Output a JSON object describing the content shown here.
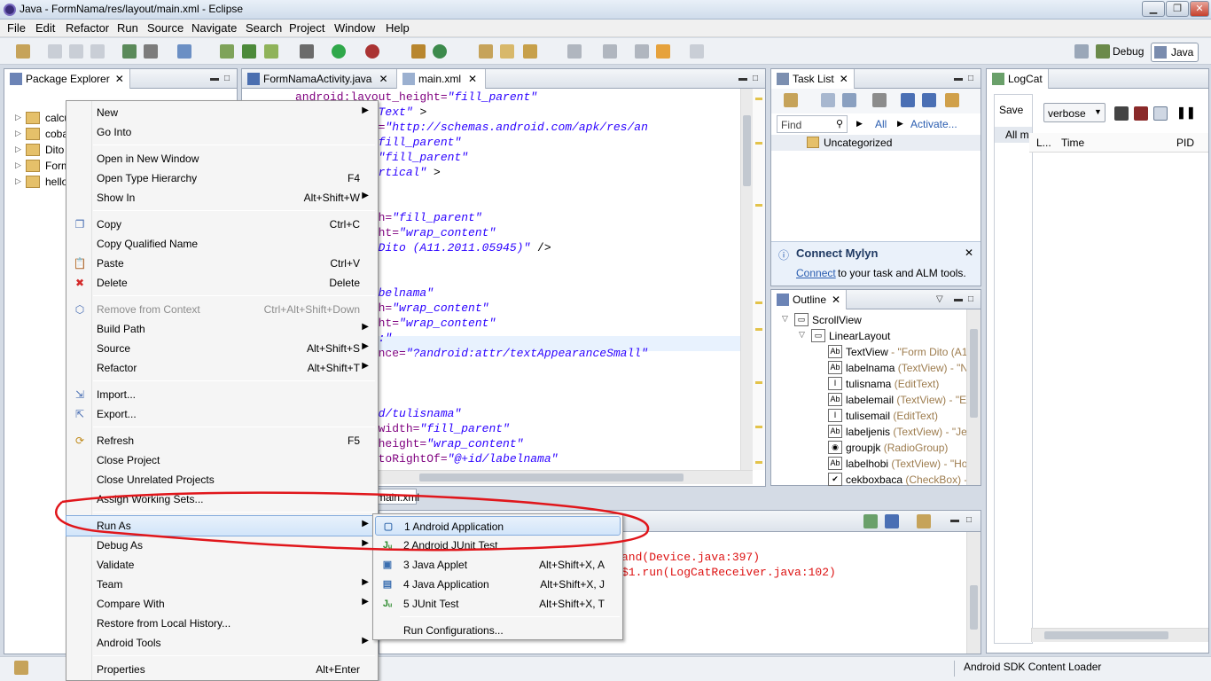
{
  "window": {
    "title": "Java - FormNama/res/layout/main.xml - Eclipse",
    "minimize": "▁",
    "maximize": "❐",
    "close": "✕"
  },
  "menubar": [
    "File",
    "Edit",
    "Refactor",
    "Run",
    "Source",
    "Navigate",
    "Search",
    "Project",
    "Window",
    "Help"
  ],
  "perspectives": {
    "debug": "Debug",
    "java": "Java"
  },
  "package_explorer": {
    "tab": "Package Explorer",
    "items": [
      "calcu",
      "coba",
      "Dito",
      "Form",
      "hello"
    ]
  },
  "editor": {
    "tabs": [
      "FormNamaActivity.java",
      "main.xml"
    ],
    "lines": [
      {
        "a": "android:layout_height=",
        "v": "\"fill_parent\"",
        "p": ""
      },
      {
        "a": "e=",
        "v": "\"HardcodedText\"",
        "p": " >"
      },
      {
        "a": "mlns:android=",
        "v": "\"http://schemas.android.com/apk/res/an",
        "p": ""
      },
      {
        "a": "yout_width=",
        "v": "\"fill_parent\"",
        "p": ""
      },
      {
        "a": "yout_height=",
        "v": "\"fill_parent\"",
        "p": ""
      },
      {
        "a": "entation=",
        "v": "\"vertical\"",
        "p": " >"
      },
      {
        "a": "",
        "v": "",
        "p": ""
      },
      {
        "a": "",
        "v": "",
        "p": ""
      },
      {
        "a": ":layout_width=",
        "v": "\"fill_parent\"",
        "p": ""
      },
      {
        "a": ":layout_height=",
        "v": "\"wrap_content\"",
        "p": ""
      },
      {
        "a": ":text=",
        "v": "\"Form Dito (A11.2011.05945)\"",
        "p": " />"
      },
      {
        "a": "",
        "v": "",
        "p": ""
      },
      {
        "a": "",
        "v": "",
        "p": ""
      },
      {
        "a": ":id=",
        "v": "\"@+id/labelnama\"",
        "p": ""
      },
      {
        "a": ":layout_width=",
        "v": "\"wrap_content\"",
        "p": ""
      },
      {
        "a": ":layout_height=",
        "v": "\"wrap_content\"",
        "p": ""
      },
      {
        "a": ":text=",
        "v": "\"Nama :\"",
        "p": ""
      },
      {
        "a": ":textAppearance=",
        "v": "\"?android:attr/textAppearanceSmall\"",
        "p": ""
      },
      {
        "a": "",
        "v": "",
        "p": ""
      },
      {
        "a": "",
        "v": "",
        "p": ""
      },
      {
        "a": "",
        "v": "",
        "p": ""
      },
      {
        "a": "roid:id=",
        "v": "\"@+id/tulisnama\"",
        "p": ""
      },
      {
        "a": "roid:layout_width=",
        "v": "\"fill_parent\"",
        "p": ""
      },
      {
        "a": "roid:layout_height=",
        "v": "\"wrap_content\"",
        "p": ""
      },
      {
        "a": "roid:layout_toRightOf=",
        "v": "\"@+id/labelnama\"",
        "p": ""
      }
    ],
    "bottom_tab": "main.xml"
  },
  "task_list": {
    "tab": "Task List",
    "find_placeholder": "Find",
    "all": "All",
    "activate": "Activate...",
    "category": "Uncategorized",
    "mylyn_title": "Connect Mylyn",
    "mylyn_link": "Connect",
    "mylyn_text": " to your task and ALM tools."
  },
  "outline": {
    "tab": "Outline",
    "items": [
      {
        "name": "ScrollView",
        "type": "",
        "indent": 0,
        "icon": "scrollview-icon",
        "glyph": "▭"
      },
      {
        "name": "LinearLayout",
        "type": "",
        "indent": 1,
        "icon": "linearlayout-icon",
        "glyph": "▭"
      },
      {
        "name": "TextView",
        "type": " - \"Form Dito (A1",
        "indent": 2,
        "icon": "textview-icon",
        "glyph": "Ab"
      },
      {
        "name": "labelnama",
        "type": " (TextView) - \"N",
        "indent": 2,
        "icon": "textview-icon",
        "glyph": "Ab"
      },
      {
        "name": "tulisnama",
        "type": " (EditText)",
        "indent": 2,
        "icon": "edittext-icon",
        "glyph": "I"
      },
      {
        "name": "labelemail",
        "type": " (TextView) - \"Ei",
        "indent": 2,
        "icon": "textview-icon",
        "glyph": "Ab"
      },
      {
        "name": "tulisemail",
        "type": " (EditText)",
        "indent": 2,
        "icon": "edittext-icon",
        "glyph": "I"
      },
      {
        "name": "labeljenis",
        "type": " (TextView) - \"Jer",
        "indent": 2,
        "icon": "textview-icon",
        "glyph": "Ab"
      },
      {
        "name": "groupjk",
        "type": " (RadioGroup)",
        "indent": 2,
        "icon": "radiogroup-icon",
        "glyph": "◉"
      },
      {
        "name": "labelhobi",
        "type": " (TextView) - \"Ho",
        "indent": 2,
        "icon": "textview-icon",
        "glyph": "Ab"
      },
      {
        "name": "cekboxbaca",
        "type": " (CheckBox) -",
        "indent": 2,
        "icon": "checkbox-icon",
        "glyph": "✔"
      }
    ]
  },
  "logcat": {
    "tab": "LogCat",
    "save": "Save",
    "all": "All m",
    "level": "verbose",
    "cols": [
      "L...",
      "Time",
      "PID"
    ]
  },
  "console": {
    "lines": [
      "and(Device.java:397)",
      "$1.run(LogCatReceiver.java:102)"
    ]
  },
  "context_menu": [
    {
      "label": "New",
      "arrow": true,
      "icon": ""
    },
    {
      "label": "Go Into",
      "icon": ""
    },
    {
      "sep": true
    },
    {
      "label": "Open in New Window",
      "icon": ""
    },
    {
      "label": "Open Type Hierarchy",
      "shortcut": "F4",
      "icon": ""
    },
    {
      "label": "Show In",
      "shortcut": "Alt+Shift+W",
      "arrow": true,
      "icon": ""
    },
    {
      "sep": true
    },
    {
      "label": "Copy",
      "shortcut": "Ctrl+C",
      "icon": "copy-icon",
      "glyph": "❐"
    },
    {
      "label": "Copy Qualified Name",
      "icon": ""
    },
    {
      "label": "Paste",
      "shortcut": "Ctrl+V",
      "icon": "paste-icon",
      "glyph": "📋"
    },
    {
      "label": "Delete",
      "shortcut": "Delete",
      "icon": "delete-icon",
      "glyph": "✖",
      "color": "#d42a2a"
    },
    {
      "sep": true
    },
    {
      "label": "Remove from Context",
      "shortcut": "Ctrl+Alt+Shift+Down",
      "disabled": true,
      "icon": "remove-context-icon",
      "glyph": "⬡"
    },
    {
      "label": "Build Path",
      "arrow": true,
      "icon": ""
    },
    {
      "label": "Source",
      "shortcut": "Alt+Shift+S",
      "arrow": true,
      "icon": ""
    },
    {
      "label": "Refactor",
      "shortcut": "Alt+Shift+T",
      "arrow": true,
      "icon": ""
    },
    {
      "sep": true
    },
    {
      "label": "Import...",
      "icon": "import-icon",
      "glyph": "⇲"
    },
    {
      "label": "Export...",
      "icon": "export-icon",
      "glyph": "⇱"
    },
    {
      "sep": true
    },
    {
      "label": "Refresh",
      "shortcut": "F5",
      "icon": "refresh-icon",
      "glyph": "⟳",
      "color": "#c08a1a"
    },
    {
      "label": "Close Project",
      "icon": ""
    },
    {
      "label": "Close Unrelated Projects",
      "icon": ""
    },
    {
      "label": "Assign Working Sets...",
      "icon": ""
    },
    {
      "sep": true
    },
    {
      "label": "Run As",
      "arrow": true,
      "icon": ""
    },
    {
      "label": "Debug As",
      "arrow": true,
      "icon": ""
    },
    {
      "label": "Validate",
      "icon": ""
    },
    {
      "label": "Team",
      "arrow": true,
      "icon": ""
    },
    {
      "label": "Compare With",
      "arrow": true,
      "icon": ""
    },
    {
      "label": "Restore from Local History...",
      "icon": ""
    },
    {
      "label": "Android Tools",
      "arrow": true,
      "icon": ""
    },
    {
      "sep": true
    },
    {
      "label": "Properties",
      "shortcut": "Alt+Enter",
      "icon": ""
    }
  ],
  "run_as_menu": [
    {
      "label": "1 Android Application",
      "icon": "android-app-icon",
      "glyph": "▢",
      "color": "#3b6fb0"
    },
    {
      "label": "2 Android JUnit Test",
      "icon": "junit-icon",
      "glyph": "Jᵤ",
      "color": "#2e8b2e"
    },
    {
      "label": "3 Java Applet",
      "shortcut": "Alt+Shift+X, A",
      "icon": "applet-icon",
      "glyph": "▣",
      "color": "#3b6fb0"
    },
    {
      "label": "4 Java Application",
      "shortcut": "Alt+Shift+X, J",
      "icon": "java-app-icon",
      "glyph": "▤",
      "color": "#3b6fb0"
    },
    {
      "label": "5 JUnit Test",
      "shortcut": "Alt+Shift+X, T",
      "icon": "junit-icon",
      "glyph": "Jᵤ",
      "color": "#2e8b2e"
    },
    {
      "sep": true
    },
    {
      "label": "Run Configurations...",
      "icon": ""
    }
  ],
  "status": {
    "right": "Android SDK Content Loader"
  },
  "colors": {
    "annotation": "#e0161b"
  }
}
